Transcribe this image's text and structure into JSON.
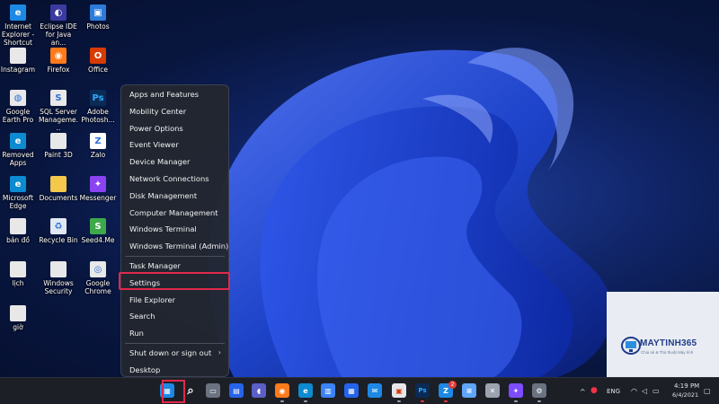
{
  "desktop": {
    "icons": [
      {
        "label": "Internet Explorer - Shortcut",
        "icon": "internet-explorer-icon",
        "color": "#1e88e5"
      },
      {
        "label": "Eclipse IDE for Java an...",
        "icon": "eclipse-icon",
        "color": "#3a3aa0"
      },
      {
        "label": "Photos",
        "icon": "photos-icon",
        "color": "#2d7bd8"
      },
      {
        "label": "Instagram",
        "icon": "file-icon",
        "color": "#e8e8e8"
      },
      {
        "label": "Firefox",
        "icon": "firefox-icon",
        "color": "#ff7a1a"
      },
      {
        "label": "Office",
        "icon": "office-icon",
        "color": "#d83b01"
      },
      {
        "label": "Google Earth Pro",
        "icon": "google-earth-icon",
        "color": "#e8e8e8"
      },
      {
        "label": "SQL Server Manageme...",
        "icon": "sql-server-icon",
        "color": "#e8e8e8"
      },
      {
        "label": "Adobe Photosh...",
        "icon": "photoshop-icon",
        "color": "#0a2b55"
      },
      {
        "label": "Removed Apps",
        "icon": "edge-icon",
        "color": "#0c8bd0"
      },
      {
        "label": "Paint 3D",
        "icon": "file-icon",
        "color": "#e8e8e8"
      },
      {
        "label": "Zalo",
        "icon": "zalo-icon",
        "color": "#ffffff"
      },
      {
        "label": "Microsoft Edge",
        "icon": "edge-icon",
        "color": "#0c8bd0"
      },
      {
        "label": "Documents",
        "icon": "folder-icon",
        "color": "#f3c84b"
      },
      {
        "label": "Messenger",
        "icon": "messenger-icon",
        "color": "#8a43f2"
      },
      {
        "label": "bản đồ",
        "icon": "file-icon",
        "color": "#e8e8e8"
      },
      {
        "label": "Recycle Bin",
        "icon": "recycle-bin-icon",
        "color": "#dfe8f3"
      },
      {
        "label": "Seed4.Me",
        "icon": "seed4me-icon",
        "color": "#3da94a"
      },
      {
        "label": "lịch",
        "icon": "file-icon",
        "color": "#e8e8e8"
      },
      {
        "label": "Windows Security",
        "icon": "file-icon",
        "color": "#e8e8e8"
      },
      {
        "label": "Google Chrome",
        "icon": "chrome-icon",
        "color": "#e8e8e8"
      },
      {
        "label": "giờ",
        "icon": "file-icon",
        "color": "#e8e8e8"
      }
    ]
  },
  "menu": {
    "group1": [
      "Apps and Features",
      "Mobility Center",
      "Power Options",
      "Event Viewer",
      "Device Manager",
      "Network Connections",
      "Disk Management",
      "Computer Management",
      "Windows Terminal",
      "Windows Terminal (Admin)"
    ],
    "group2": [
      "Task Manager",
      "Settings",
      "File Explorer",
      "Search",
      "Run"
    ],
    "group3_shutdown": "Shut down or sign out",
    "group3_desktop": "Desktop",
    "highlighted": "Settings"
  },
  "taskbar": {
    "icons": [
      "start-icon",
      "search-icon",
      "task-view-icon",
      "widgets-icon",
      "chat-icon",
      "firefox-icon",
      "edge-icon",
      "store-icon",
      "calendar-icon",
      "mail-icon",
      "office-icon",
      "photoshop-icon",
      "zalo-icon",
      "notepad-icon",
      "tools-icon",
      "messenger-icon",
      "settings-icon"
    ],
    "badge": "2",
    "language": "ENG",
    "time": "4:19 PM",
    "date": "6/4/2021"
  },
  "watermark": {
    "brand": "MAYTINH365",
    "tagline": "Chia sẻ & Thủ thuật Máy tính"
  },
  "colors": {
    "highlight": "#e0294a",
    "menu_bg": "#22262f",
    "taskbar_bg": "#1c1f26"
  }
}
